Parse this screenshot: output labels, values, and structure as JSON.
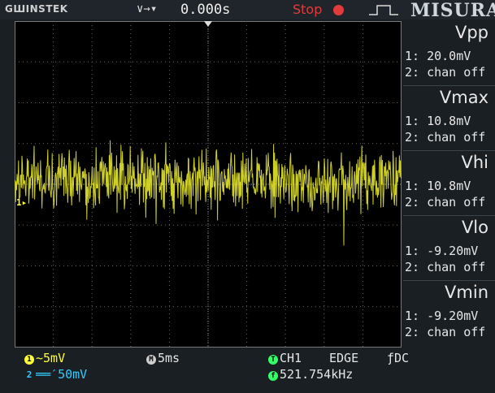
{
  "header": {
    "brand": "GШINSTEK",
    "trigger_arrows": "∨→▾",
    "timebase_offset": "0.000s",
    "run_status": "Stop",
    "watermark": "MISURA"
  },
  "measurements": [
    {
      "title": "Vpp",
      "ch1": "1: 20.0mV",
      "ch2": "2: chan off"
    },
    {
      "title": "Vmax",
      "ch1": "1: 10.8mV",
      "ch2": "2: chan off"
    },
    {
      "title": "Vhi",
      "ch1": "1: 10.8mV",
      "ch2": "2: chan off"
    },
    {
      "title": "Vlo",
      "ch1": "1: -9.20mV",
      "ch2": "2: chan off"
    },
    {
      "title": "Vmin",
      "ch1": "1: -9.20mV",
      "ch2": "2: chan off"
    }
  ],
  "channels": {
    "ch1_badge": "1",
    "ch1_scale": "~5mV",
    "ch2_badge": "2",
    "ch2_scale": "══′50mV"
  },
  "timebase": {
    "badge": "M",
    "value": "5ms"
  },
  "trigger": {
    "badge": "T",
    "source": "CH1",
    "type": "EDGE",
    "coupling": "ƒDC",
    "freq_badge": "f",
    "frequency": "521.754kHz"
  },
  "marker": {
    "ch1": "1▸"
  },
  "colors": {
    "ch1": "#ffff33",
    "ch2": "#33ccff",
    "trigger": "#33ff66",
    "stop": "#e23b3b",
    "trace": "#e6e62e"
  }
}
